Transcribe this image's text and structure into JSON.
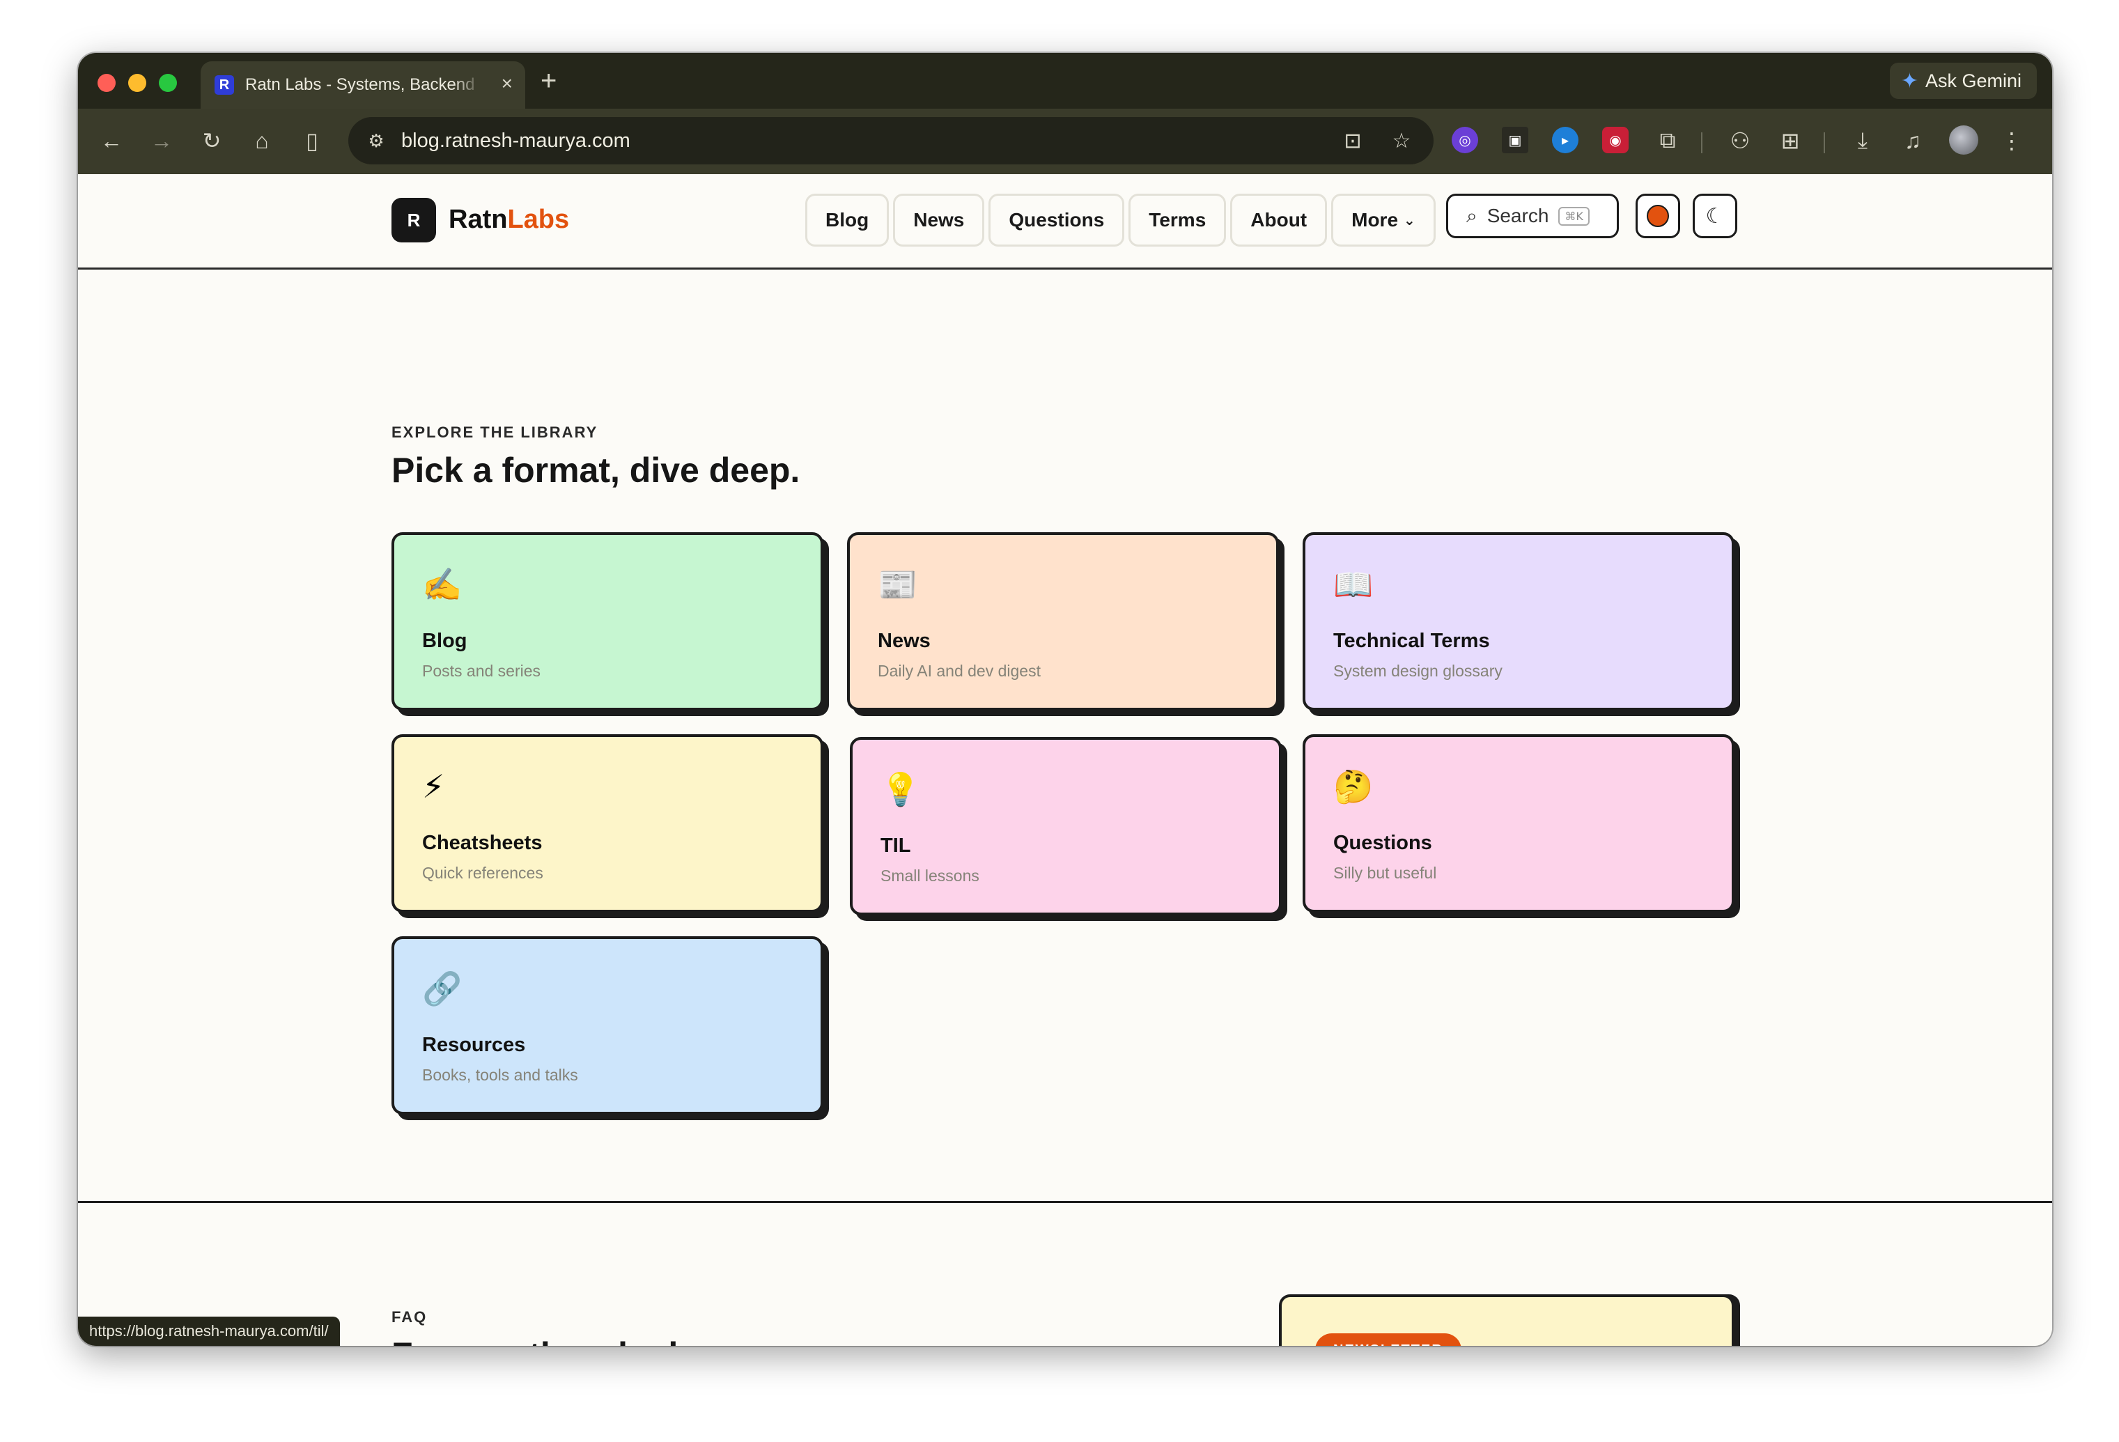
{
  "browser": {
    "tab_title": "Ratn Labs - Systems, Backend",
    "tab_favicon": "R",
    "new_tab": "+",
    "tab_close": "×",
    "ask_gemini": "Ask Gemini",
    "url": "blog.ratnesh-maurya.com",
    "status_url": "https://blog.ratnesh-maurya.com/til/"
  },
  "site": {
    "logo_mark": "R",
    "logo_text_a": "Ratn",
    "logo_text_b": "Labs",
    "accent_color": "#e2520f",
    "nav": [
      {
        "label": "Blog"
      },
      {
        "label": "News"
      },
      {
        "label": "Questions"
      },
      {
        "label": "Terms"
      },
      {
        "label": "About"
      },
      {
        "label": "More"
      }
    ],
    "search_label": "Search",
    "search_shortcut": "⌘K"
  },
  "library": {
    "eyebrow": "EXPLORE THE LIBRARY",
    "title": "Pick a format, dive deep.",
    "cards": [
      {
        "icon": "✍️",
        "title": "Blog",
        "subtitle": "Posts and series",
        "color": "#c6f6d1"
      },
      {
        "icon": "📰",
        "title": "News",
        "subtitle": "Daily AI and dev digest",
        "color": "#ffe2cc"
      },
      {
        "icon": "📖",
        "title": "Technical Terms",
        "subtitle": "System design glossary",
        "color": "#e7dcfd"
      },
      {
        "icon": "⚡",
        "title": "Cheatsheets",
        "subtitle": "Quick references",
        "color": "#fdf5c9"
      },
      {
        "icon": "💡",
        "title": "TIL",
        "subtitle": "Small lessons",
        "color": "#fdd3ea"
      },
      {
        "icon": "🤔",
        "title": "Questions",
        "subtitle": "Silly but useful",
        "color": "#fdd3ea"
      },
      {
        "icon": "🔗",
        "title": "Resources",
        "subtitle": "Books, tools and talks",
        "color": "#cde5fb"
      }
    ]
  },
  "faq": {
    "eyebrow": "FAQ",
    "title": "Frequently asked."
  },
  "newsletter": {
    "badge": "NEWSLETTER"
  }
}
